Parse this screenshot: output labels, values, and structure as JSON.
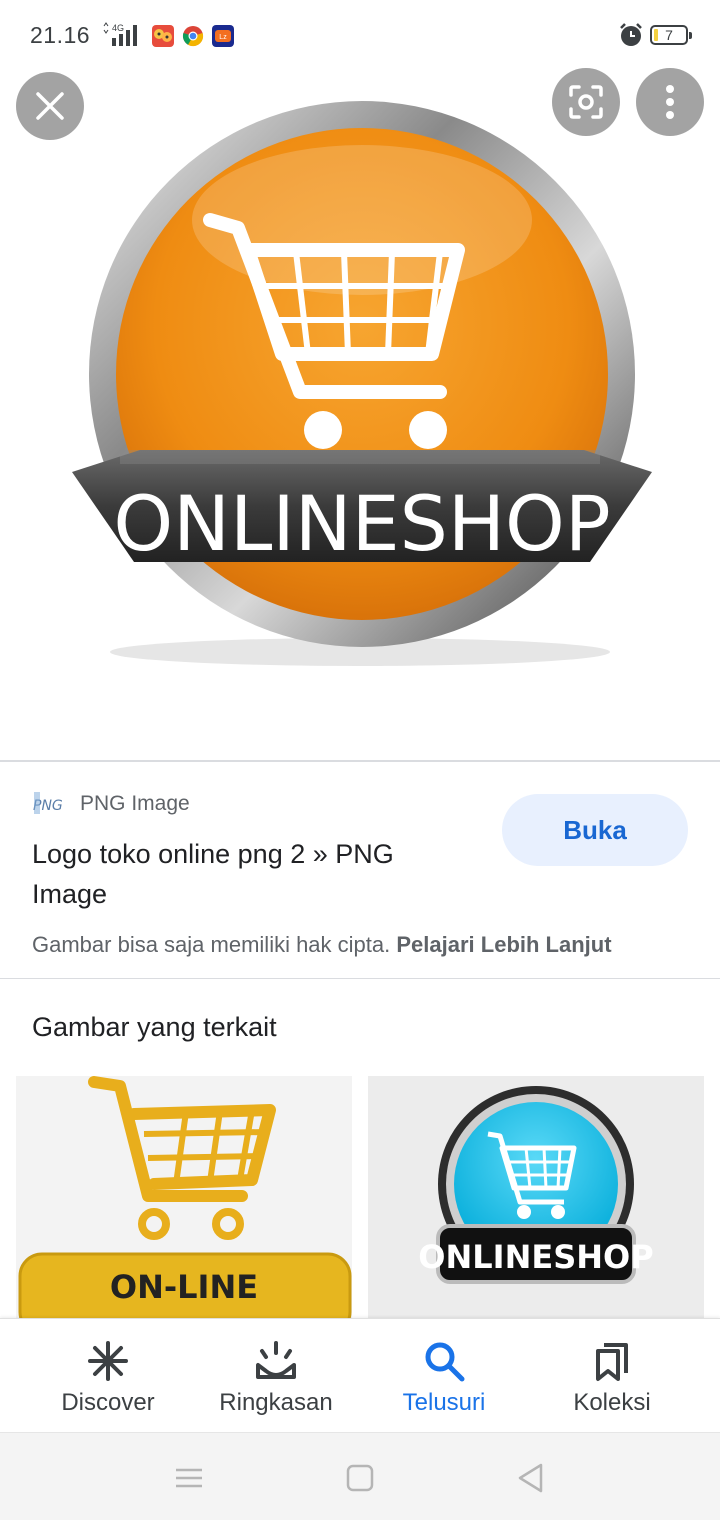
{
  "status_bar": {
    "time": "21.16",
    "network": "4G",
    "battery": "7",
    "icons": [
      "signal-icon",
      "game-app-icon",
      "chrome-icon",
      "lazada-icon",
      "alarm-icon",
      "battery-icon"
    ]
  },
  "viewer": {
    "close_icon": "close-icon",
    "lens_icon": "lens-icon",
    "more_icon": "more-vert-icon",
    "image_text": "ONLINESHOP"
  },
  "result": {
    "source_name": "PNG Image",
    "title": "Logo toko online png 2 » PNG Image",
    "open_label": "Buka",
    "copyright_text": "Gambar bisa saja memiliki hak cipta.",
    "learn_more": "Pelajari Lebih Lanjut"
  },
  "related": {
    "heading": "Gambar yang terkait",
    "items": [
      {
        "text": "ON-LINE"
      },
      {
        "text": "ONLINESHOP"
      }
    ]
  },
  "bottom_nav": {
    "items": [
      {
        "label": "Discover",
        "icon": "asterisk-icon"
      },
      {
        "label": "Ringkasan",
        "icon": "sunrise-icon"
      },
      {
        "label": "Telusuri",
        "icon": "search-icon"
      },
      {
        "label": "Koleksi",
        "icon": "bookmarks-icon"
      }
    ],
    "active_color": "#1a73e8",
    "inactive_color": "#3c4043"
  },
  "colors": {
    "accent": "#1a73e8",
    "button_bg": "#e8f0fe",
    "logo_orange": "#f0941f",
    "logo_cyan": "#1ec8f0"
  }
}
